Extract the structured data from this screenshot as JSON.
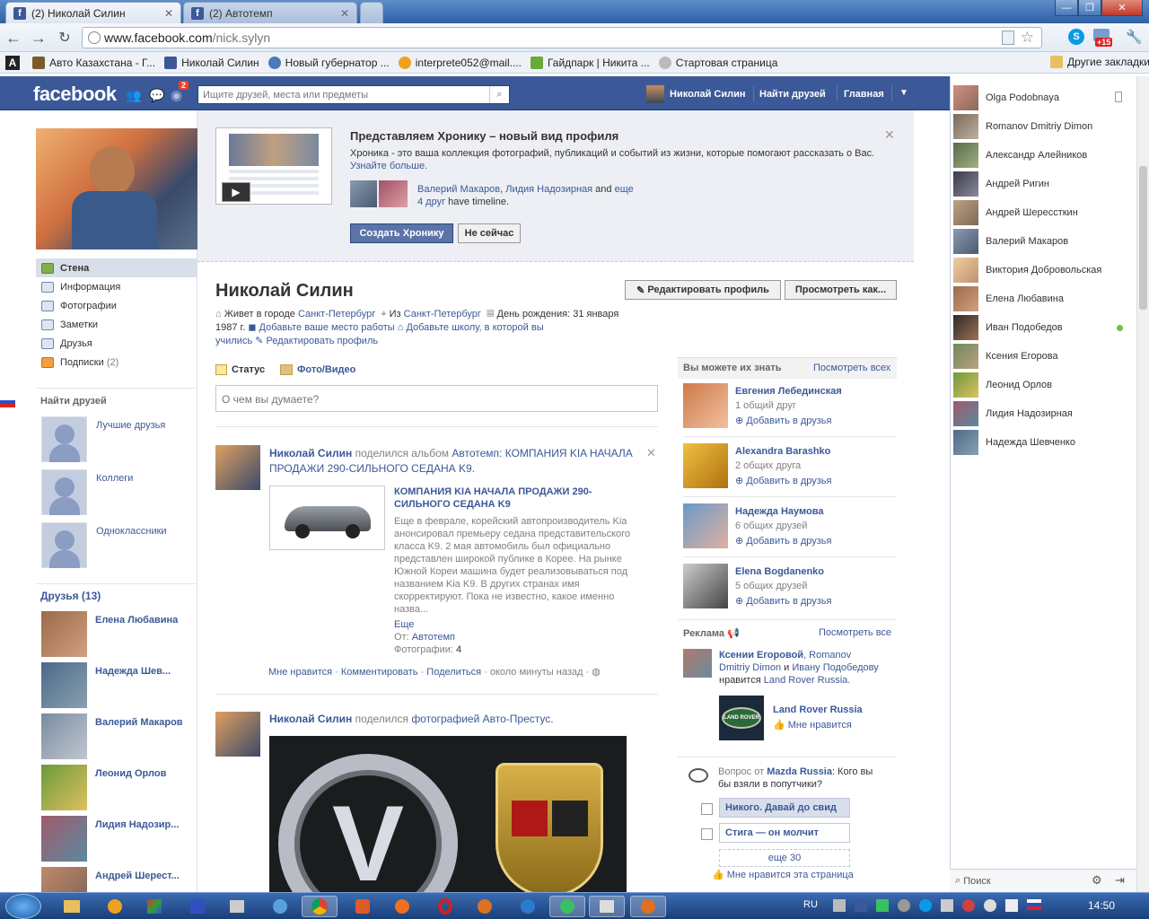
{
  "browser": {
    "tabs": [
      {
        "label": "(2) Николай Силин"
      },
      {
        "label": "(2) Автотемп"
      }
    ],
    "url_domain": "www.facebook.com",
    "url_path": "/nick.sylyn",
    "notif_badge": "+15",
    "bookmarks": [
      {
        "label": "Авто Казахстана - Г..."
      },
      {
        "label": "Николай Силин"
      },
      {
        "label": "Новый губернатор ..."
      },
      {
        "label": "interprete052@mail...."
      },
      {
        "label": "Гайдпарк | Никита ..."
      },
      {
        "label": "Стартовая страница"
      }
    ],
    "other_bookmarks": "Другие закладки"
  },
  "fb_header": {
    "logo": "facebook",
    "notif_count": "2",
    "search_placeholder": "Ищите друзей, места или предметы",
    "user_name": "Николай Силин",
    "find_friends": "Найти друзей",
    "home": "Главная"
  },
  "left_nav": {
    "items": [
      {
        "label": "Стена"
      },
      {
        "label": "Информация"
      },
      {
        "label": "Фотографии"
      },
      {
        "label": "Заметки"
      },
      {
        "label": "Друзья"
      },
      {
        "label": "Подписки",
        "count": "(2)"
      }
    ],
    "find_friends_heading": "Найти друзей",
    "lists": [
      {
        "label": "Лучшие друзья"
      },
      {
        "label": "Коллеги"
      },
      {
        "label": "Одноклассники"
      }
    ],
    "friends_heading": "Друзья (13)",
    "friends": [
      {
        "name": "Елена Любавина"
      },
      {
        "name": "Надежда Шев..."
      },
      {
        "name": "Валерий Макаров"
      },
      {
        "name": "Леонид Орлов"
      },
      {
        "name": "Лидия Надозир..."
      },
      {
        "name": "Андрей Шерест..."
      }
    ]
  },
  "timeline_promo": {
    "title": "Представляем Хронику – новый вид профиля",
    "desc": "Хроника - это ваша коллекция фотографий, публикаций и событий из жизни, которые помогают рассказать о Вас.",
    "learn_more": "Узнайте больше.",
    "friend1": "Валерий Макаров",
    "comma": ",",
    "friend2": "Лидия Надозирная",
    "and": "and",
    "more": "еще",
    "count_link": "4 друг",
    "has_timeline": "have timeline.",
    "create_btn": "Создать Хронику",
    "later_btn": "Не сейчас"
  },
  "profile": {
    "name": "Николай Силин",
    "edit_btn": "Редактировать профиль",
    "view_as_btn": "Просмотреть как...",
    "lives_prefix": "Живет в городе",
    "lives_city": "Санкт-Петербург",
    "from_prefix": "Из",
    "from_city": "Санкт-Петербург",
    "birthday": "День рождения: 31 января",
    "birthday_year": "1987 г.",
    "add_work": "Добавьте ваше место работы",
    "add_school": "Добавьте школу, в которой вы",
    "add_school2": "учились",
    "edit_profile": "Редактировать профиль"
  },
  "composer": {
    "status_tab": "Статус",
    "photo_tab": "Фото/Видео",
    "placeholder": "О чем вы думаете?"
  },
  "stories": [
    {
      "author": "Николай Силин",
      "verb": "поделился альбом",
      "target": "Автотемп: КОМПАНИЯ KIA НАЧАЛА ПРОДАЖИ 290-СИЛЬНОГО СЕДАНА K9.",
      "attach_title": "КОМПАНИЯ KIA НАЧАЛА ПРОДАЖИ 290-СИЛЬНОГО СЕДАНА K9",
      "attach_text": "Еще в феврале, корейский автопроизводитель Kia анонсировал премьеру седана представительского класса K9. 2 мая автомобиль был официально представлен широкой публике в Корее. На рынке Южной Кореи машина будет реализовываться под названием Kia K9. В других странах имя скорректируют. Пока не известно, какое именно назва...",
      "more": "Еще",
      "from_label": "От:",
      "from_value": "Автотемп",
      "photos_label": "Фотографии:",
      "photos_value": "4",
      "like": "Мне нравится",
      "comment": "Комментировать",
      "share": "Поделиться",
      "time": "около минуты назад"
    },
    {
      "author": "Николай Силин",
      "verb": "поделился",
      "target": "фотографией Авто-Престус."
    }
  ],
  "pymk": {
    "heading": "Вы можете их знать",
    "see_all": "Посмотреть всех",
    "people": [
      {
        "name": "Евгения Лебединская",
        "mutual": "1 общий друг",
        "add": "Добавить в друзья"
      },
      {
        "name": "Alexandra Barashko",
        "mutual": "2 общих друга",
        "add": "Добавить в друзья"
      },
      {
        "name": "Надежда Наумова",
        "mutual": "6 общих друзей",
        "add": "Добавить в друзья"
      },
      {
        "name": "Elena Bogdanenko",
        "mutual": "5 общих друзей",
        "add": "Добавить в друзья"
      }
    ]
  },
  "ads": {
    "heading": "Реклама",
    "see_all": "Посмотреть все",
    "social_a": "Ксении Егоровой",
    "social_b": ", Romanov",
    "social_c": "Dmitriy Dimon",
    "social_d": "и",
    "social_e": "Ивану Подобедову",
    "social_f": "нравится",
    "social_g": "Land Rover Russia.",
    "page_name": "Land Rover Russia",
    "page_like": "Мне нравится",
    "logo_text": "LAND ROVER"
  },
  "question": {
    "prefix": "Вопрос от",
    "from": "Mazda Russia",
    "text": ": Кого вы",
    "text2": "бы взяли в попутчики?",
    "opt1": "Никого. Давай до свид",
    "opt2": "Стига — он молчит",
    "more": "еще 30",
    "like_page": "Мне нравится эта страница"
  },
  "chat": {
    "contacts": [
      {
        "name": "Olga Podobnaya"
      },
      {
        "name": "Romanov Dmitriy Dimon"
      },
      {
        "name": "Александр Алейников"
      },
      {
        "name": "Андрей Ригин"
      },
      {
        "name": "Андрей Шерессткин"
      },
      {
        "name": "Валерий Макаров"
      },
      {
        "name": "Виктория Добровольская"
      },
      {
        "name": "Елена Любавина"
      },
      {
        "name": "Иван Подобедов"
      },
      {
        "name": "Ксения Егорова"
      },
      {
        "name": "Леонид Орлов"
      },
      {
        "name": "Лидия Надозирная"
      },
      {
        "name": "Надежда Шевченко"
      }
    ],
    "search": "Поиск",
    "online_color": "#6ac243"
  },
  "taskbar": {
    "lang": "RU",
    "time": "14:50"
  },
  "colors": {
    "fb_blue": "#3b5998",
    "link": "#3b5998"
  }
}
